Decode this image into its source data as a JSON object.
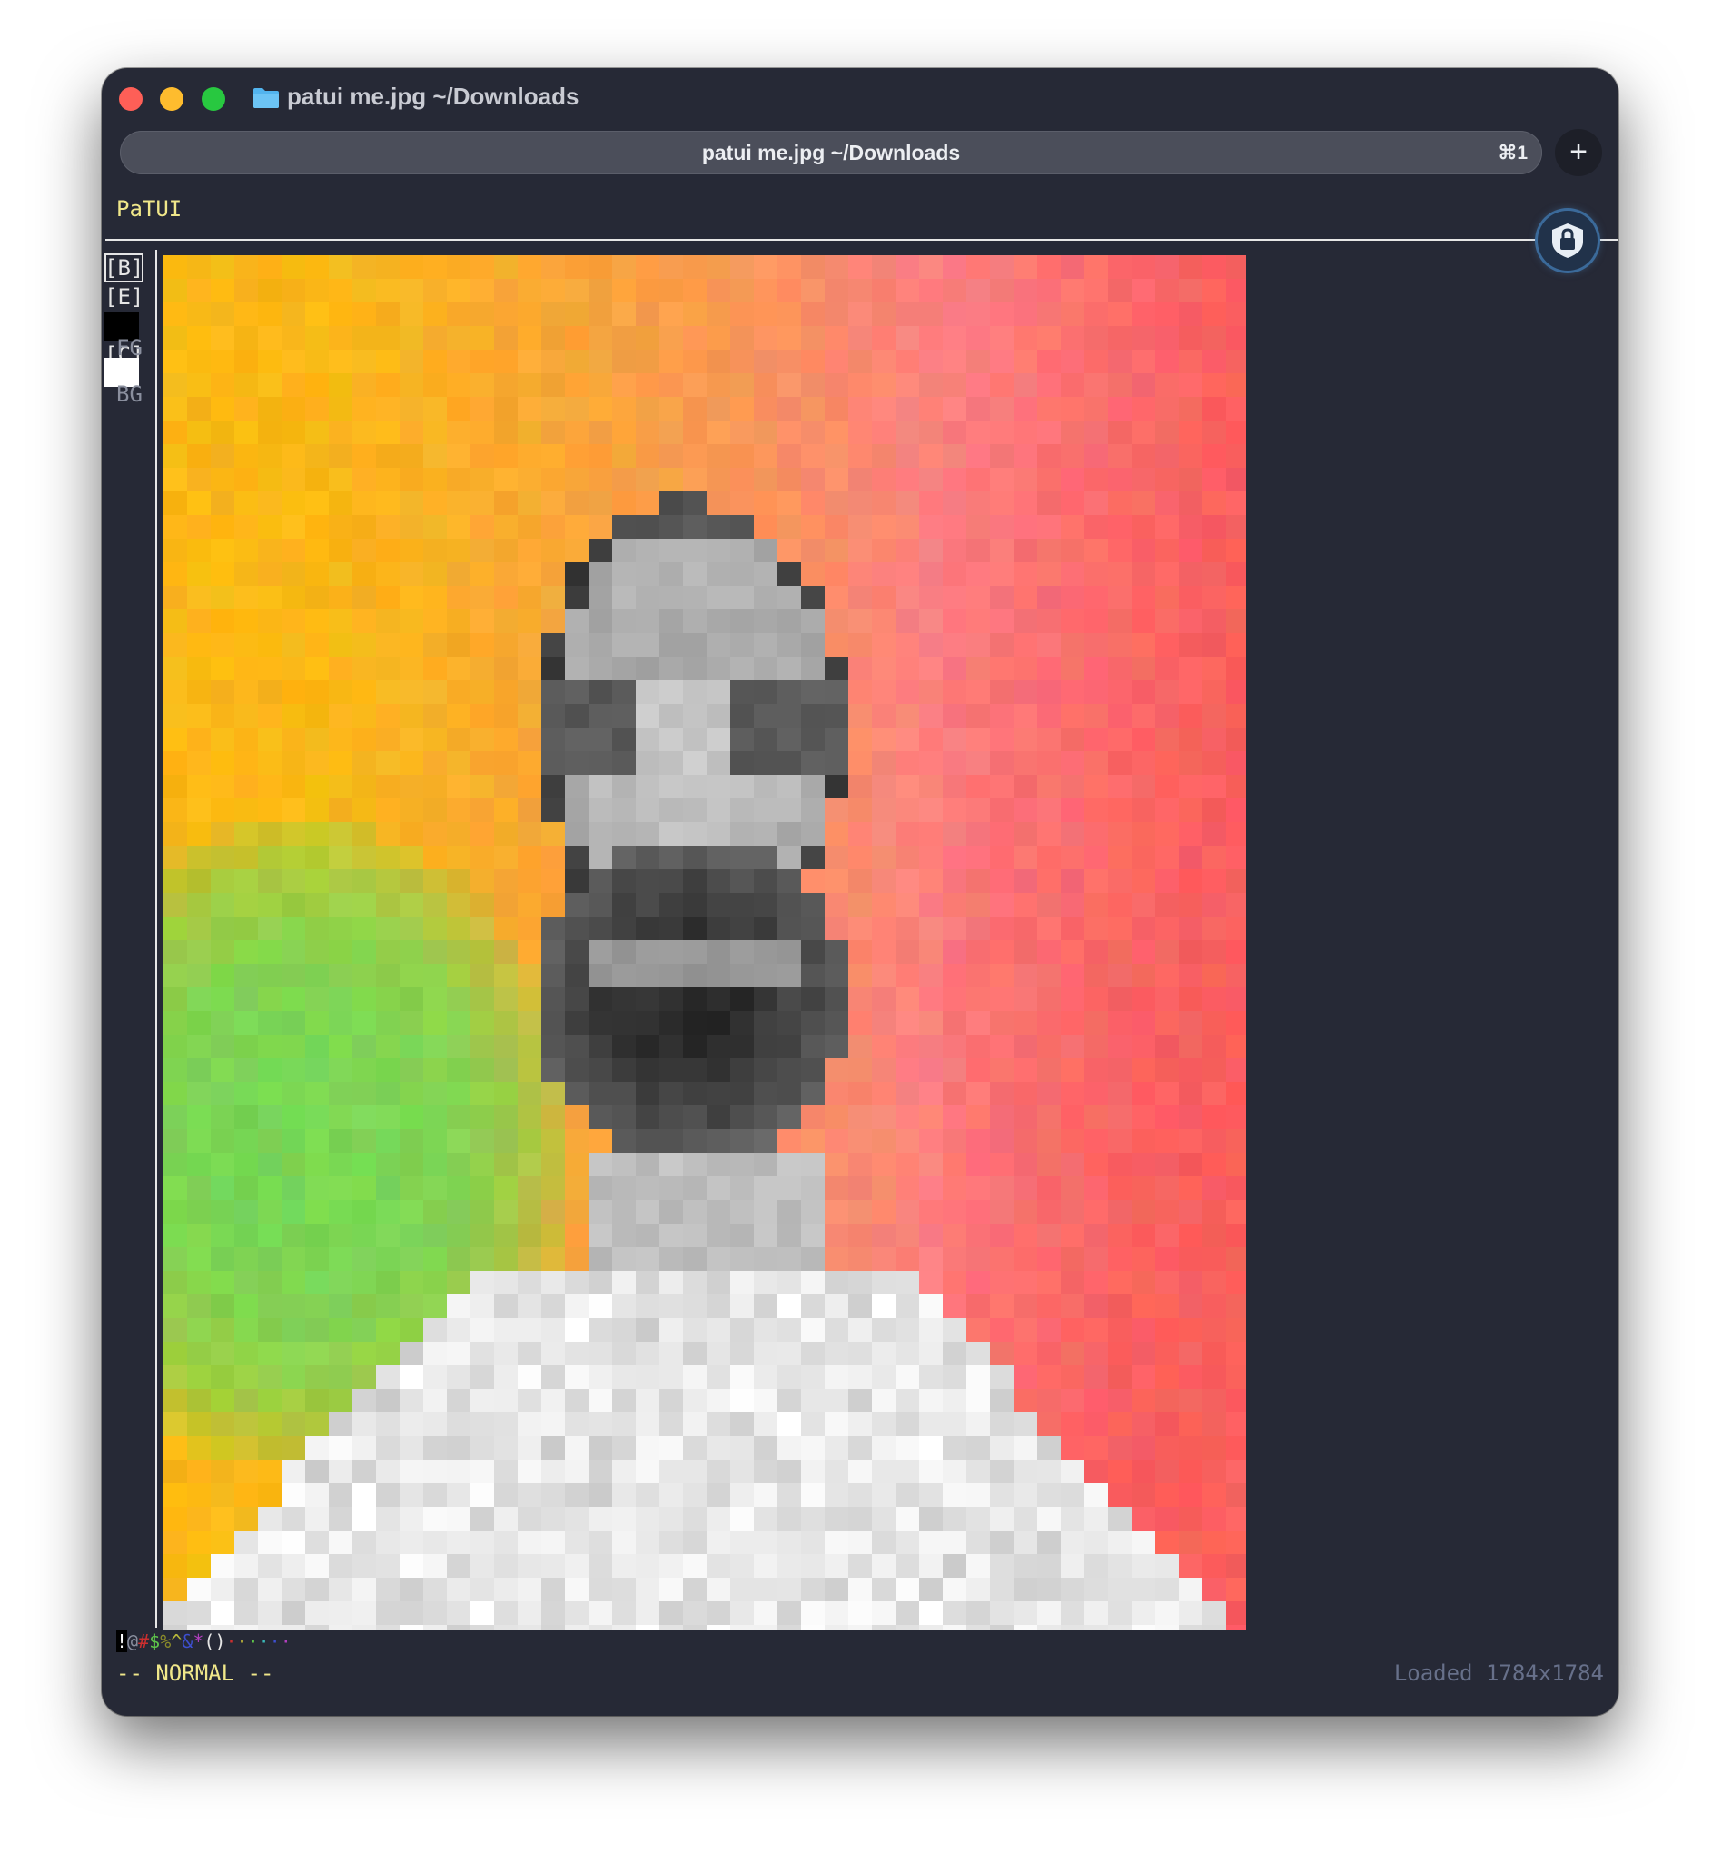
{
  "window": {
    "title": "patui me.jpg ~/Downloads",
    "tab_title": "patui me.jpg ~/Downloads",
    "tab_shortcut": "⌘1",
    "new_tab_label": "+"
  },
  "app": {
    "name": "PaTUI"
  },
  "tools": [
    {
      "label": "[B]",
      "active": true
    },
    {
      "label": "[E]",
      "active": false
    },
    {
      "label": "[F]",
      "active": false
    },
    {
      "label": "[C]",
      "active": false
    }
  ],
  "colors": {
    "fg_label": "FG",
    "bg_label": "BG",
    "fg_color": "#000000",
    "bg_color": "#ffffff"
  },
  "palette": [
    {
      "char": "!",
      "color": "#ffffff",
      "selected": true
    },
    {
      "char": "@",
      "color": "#8a8f9e"
    },
    {
      "char": "#",
      "color": "#cc2f2f"
    },
    {
      "char": "$",
      "color": "#5ec44a"
    },
    {
      "char": "%",
      "color": "#8a8a2a"
    },
    {
      "char": "^",
      "color": "#b9b93a"
    },
    {
      "char": "&",
      "color": "#3d4fd0"
    },
    {
      "char": "*",
      "color": "#b23fbf"
    },
    {
      "char": "(",
      "color": "#e6e6e6"
    },
    {
      "char": ")",
      "color": "#e6e6e6"
    },
    {
      "char": "·",
      "color": "#cc2f2f"
    },
    {
      "char": "·",
      "color": "#d4c93a"
    },
    {
      "char": "·",
      "color": "#5ec44a"
    },
    {
      "char": "·",
      "color": "#3ab8b8"
    },
    {
      "char": "·",
      "color": "#3d4fd0"
    },
    {
      "char": "·",
      "color": "#b23fbf"
    }
  ],
  "statusbar": {
    "mode": "-- NORMAL --",
    "message": "Loaded 1784x1784"
  },
  "canvas": {
    "description_color_left": "#7cd657",
    "description_color_top": "#f9b21a"
  }
}
